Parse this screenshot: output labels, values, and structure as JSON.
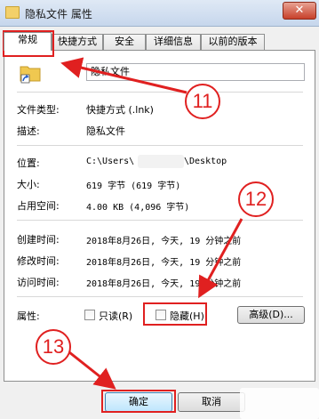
{
  "window": {
    "title": "隐私文件 属性",
    "close_glyph": "✕"
  },
  "tabs": [
    "常规",
    "快捷方式",
    "安全",
    "详细信息",
    "以前的版本"
  ],
  "general": {
    "file_name": "隐私文件",
    "file_type_label": "文件类型:",
    "file_type_value": "快捷方式 (.lnk)",
    "description_label": "描述:",
    "description_value": "隐私文件",
    "location_label": "位置:",
    "location_prefix": "C:\\Users\\",
    "location_suffix": "\\Desktop",
    "size_label": "大小:",
    "size_value": "619 字节 (619 字节)",
    "disk_label": "占用空间:",
    "disk_value": "4.00 KB (4,096 字节)",
    "created_label": "创建时间:",
    "created_value": "2018年8月26日, 今天, 19 分钟之前",
    "modified_label": "修改时间:",
    "modified_value": "2018年8月26日, 今天, 19 分钟之前",
    "accessed_label": "访问时间:",
    "accessed_value": "2018年8月26日, 今天, 19 分钟之前",
    "attributes_label": "属性:",
    "readonly_label": "只读(R)",
    "hidden_label": "隐藏(H)",
    "advanced_label": "高级(D)..."
  },
  "buttons": {
    "ok": "确定",
    "cancel": "取消"
  },
  "annotations": {
    "step1": "11",
    "step2": "12",
    "step3": "13",
    "color": "#e02020"
  }
}
